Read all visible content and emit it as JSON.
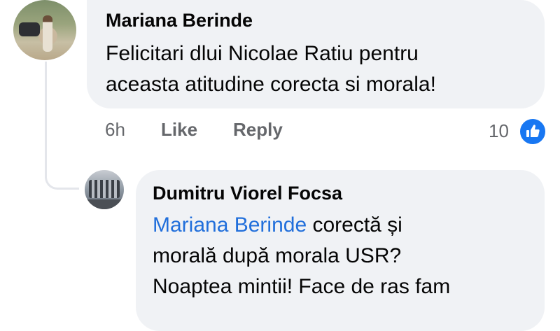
{
  "comment": {
    "author": "Mariana Berinde",
    "lines": [
      "Felicitari dlui Nicolae Ratiu pentru",
      "aceasta atitudine corecta si morala!"
    ],
    "time": "6h",
    "like_label": "Like",
    "reply_label": "Reply",
    "reaction_count": "10",
    "reaction_icon": "thumbs-up-icon"
  },
  "reply": {
    "author": "Dumitru Viorel Focsa",
    "mention": "Mariana Berinde",
    "line1_rest": " corectă și",
    "lines": [
      "morală după morala USR?",
      "Noaptea mintii! Face de ras fam"
    ]
  },
  "colors": {
    "bubble": "#f0f2f5",
    "mention": "#216fdb",
    "meta": "#65676b",
    "like_blue": "#1877f2"
  }
}
